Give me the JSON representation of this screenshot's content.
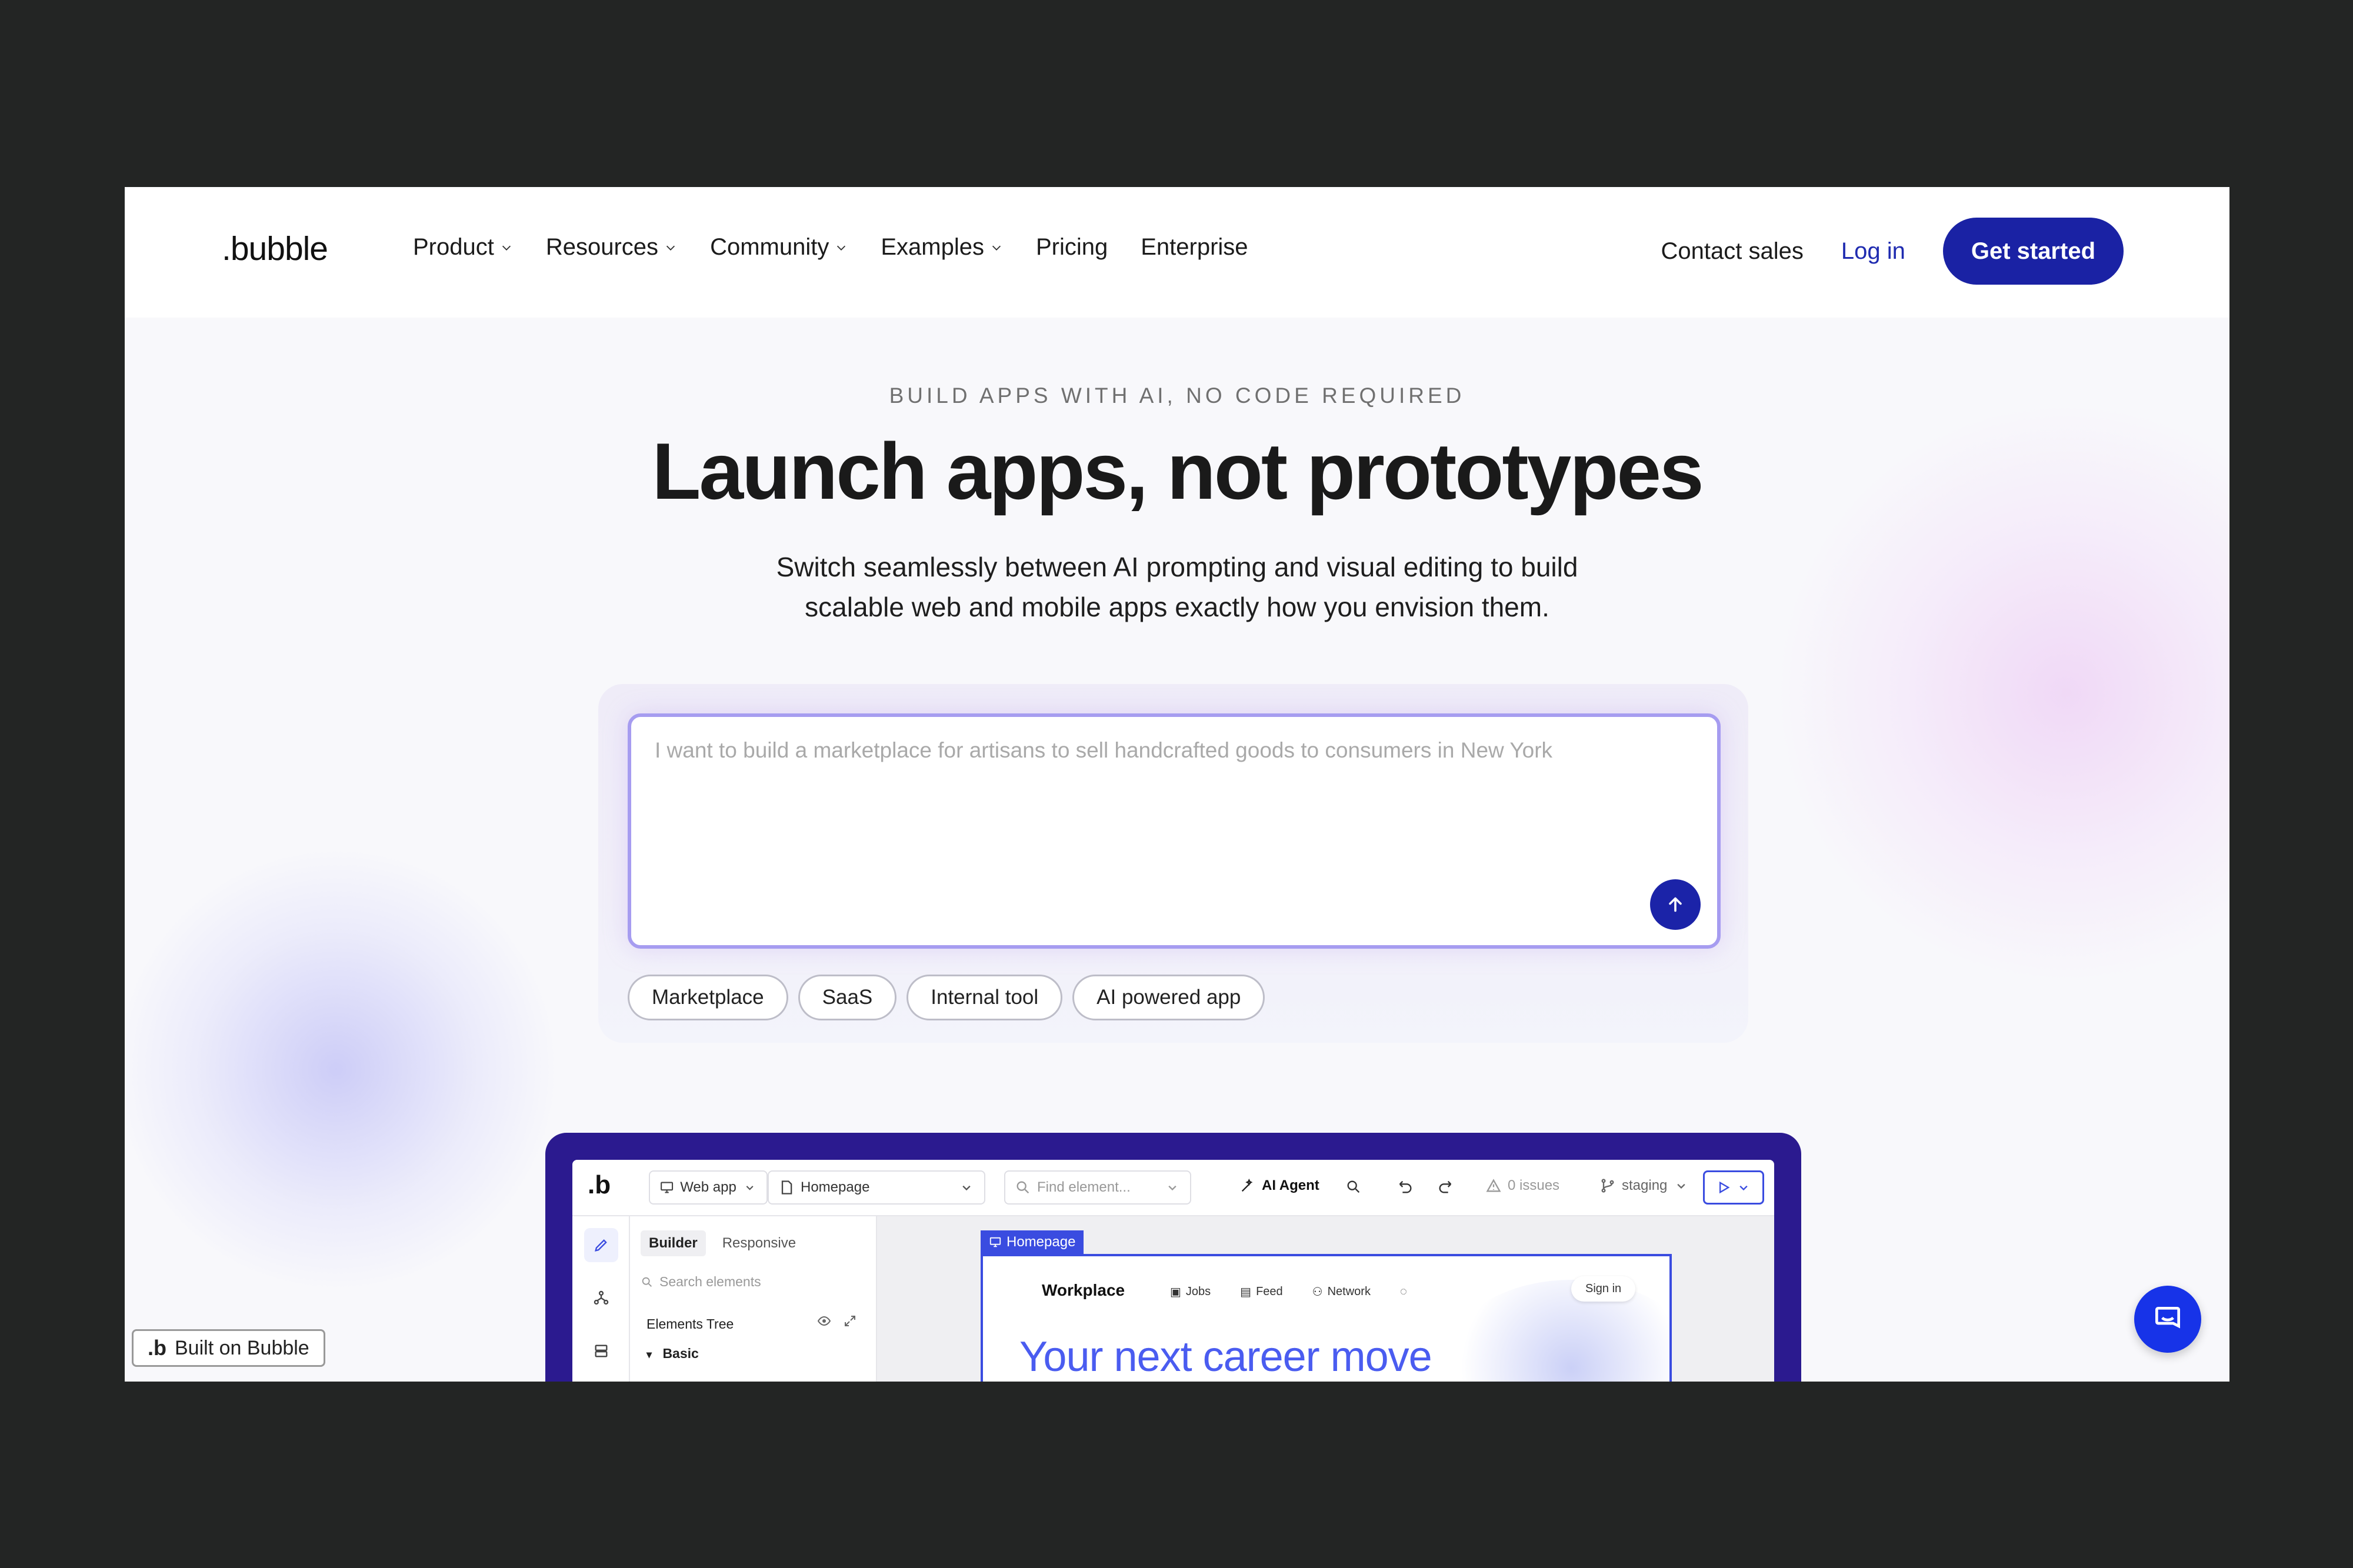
{
  "header": {
    "logo": ".bubble",
    "nav": [
      {
        "label": "Product",
        "dropdown": true
      },
      {
        "label": "Resources",
        "dropdown": true
      },
      {
        "label": "Community",
        "dropdown": true
      },
      {
        "label": "Examples",
        "dropdown": true
      },
      {
        "label": "Pricing",
        "dropdown": false
      },
      {
        "label": "Enterprise",
        "dropdown": false
      }
    ],
    "contact_sales": "Contact sales",
    "login": "Log in",
    "get_started": "Get started"
  },
  "hero": {
    "eyebrow": "BUILD APPS WITH AI, NO CODE REQUIRED",
    "headline": "Launch apps, not prototypes",
    "subtitle_line1": "Switch seamlessly between AI prompting and visual editing to build",
    "subtitle_line2": "scalable web and mobile apps exactly how you envision them."
  },
  "prompt": {
    "placeholder": "I want to build a marketplace for artisans to sell handcrafted goods to consumers in New York",
    "chips": [
      "Marketplace",
      "SaaS",
      "Internal tool",
      "AI powered app"
    ]
  },
  "editor": {
    "logo": ".b",
    "app_type": "Web app",
    "page": "Homepage",
    "find_placeholder": "Find element...",
    "ai_agent": "AI Agent",
    "issues": "0 issues",
    "branch": "staging",
    "tabs": [
      "Builder",
      "Responsive"
    ],
    "search_placeholder": "Search elements",
    "elements_tree": "Elements Tree",
    "basic": "Basic",
    "canvas": {
      "tag": "Homepage",
      "brand": "Workplace",
      "links": [
        "Jobs",
        "Feed",
        "Network"
      ],
      "signin": "Sign in",
      "hero": "Your next career move"
    }
  },
  "badges": {
    "built_on": "Built on Bubble"
  },
  "colors": {
    "brand_blue": "#1a22a4",
    "editor_frame": "#2b1a8f",
    "chat_button": "#1733e8",
    "page_bg": "#232524"
  },
  "icons": {
    "chat": "chat-bubble-icon",
    "send": "arrow-up-icon"
  }
}
